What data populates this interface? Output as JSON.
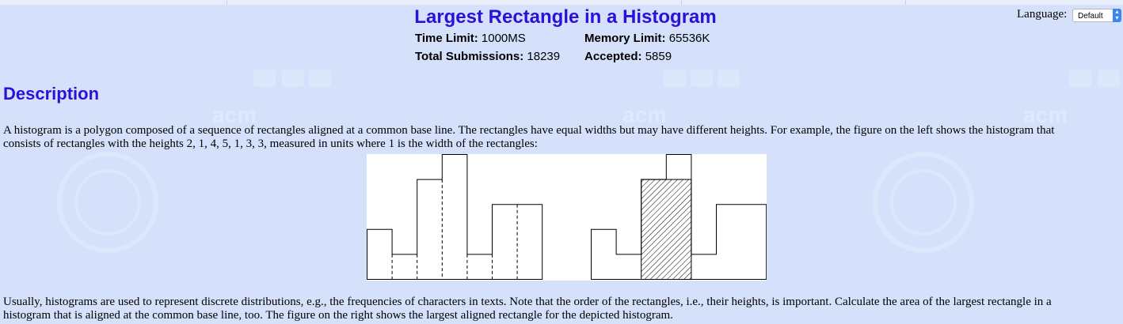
{
  "header": {
    "title": "Largest Rectangle in a Histogram",
    "language_label": "Language:",
    "language_selected": "Default"
  },
  "limits": {
    "time_label": "Time Limit:",
    "time_value": "1000MS",
    "memory_label": "Memory Limit:",
    "memory_value": "65536K",
    "submissions_label": "Total Submissions:",
    "submissions_value": "18239",
    "accepted_label": "Accepted:",
    "accepted_value": "5859"
  },
  "description": {
    "heading": "Description",
    "para1_line1": "A histogram is a polygon composed of a sequence of rectangles aligned at a common base line. The rectangles have equal widths but may have different heights. For example, the figure on the left shows the histogram that",
    "para1_line2": "consists of rectangles with the heights 2, 1, 4, 5, 1, 3, 3, measured in units where 1 is the width of the rectangles:",
    "para2_line1": "Usually, histograms are used to represent discrete distributions, e.g., the frequencies of characters in texts. Note that the order of the rectangles, i.e., their heights, is important. Calculate the area of the largest rectangle in a",
    "para2_line2": "histogram that is aligned at the common base line, too. The figure on the right shows the largest aligned rectangle for the depicted histogram."
  },
  "figure": {
    "heights": [
      2,
      1,
      4,
      5,
      1,
      3,
      3
    ],
    "largest_rectangle": {
      "start_index": 2,
      "width": 2,
      "height": 4
    }
  }
}
